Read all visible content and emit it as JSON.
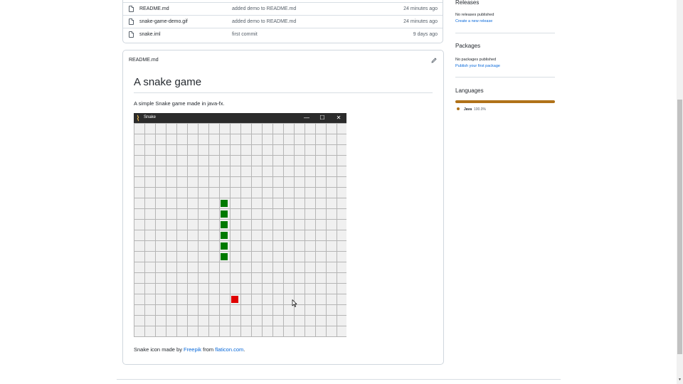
{
  "files": [
    {
      "name": "README.md",
      "message": "added demo to README.md",
      "age": "24 minutes ago"
    },
    {
      "name": "snake-game-demo.gif",
      "message": "added demo to README.md",
      "age": "24 minutes ago"
    },
    {
      "name": "snake.iml",
      "message": "first commit",
      "age": "9 days ago"
    }
  ],
  "readme": {
    "header": "README.md",
    "title": "A snake game",
    "description": "A simple Snake game made in java-fx.",
    "credit_prefix": "Snake icon made by ",
    "credit_author": "Freepik",
    "credit_middle": " from ",
    "credit_site": "flaticon.com",
    "credit_suffix": "."
  },
  "demo": {
    "window_title": "Snake",
    "min_glyph": "—",
    "max_glyph": "☐",
    "close_glyph": "✕",
    "snake_color": "#007a00",
    "food_color": "#e00000"
  },
  "sidebar": {
    "releases": {
      "heading": "Releases",
      "text": "No releases published",
      "link": "Create a new release"
    },
    "packages": {
      "heading": "Packages",
      "text": "No packages published",
      "link": "Publish your first package"
    },
    "languages": {
      "heading": "Languages",
      "name": "Java",
      "percent": "100.0%",
      "color": "#b07219"
    }
  }
}
